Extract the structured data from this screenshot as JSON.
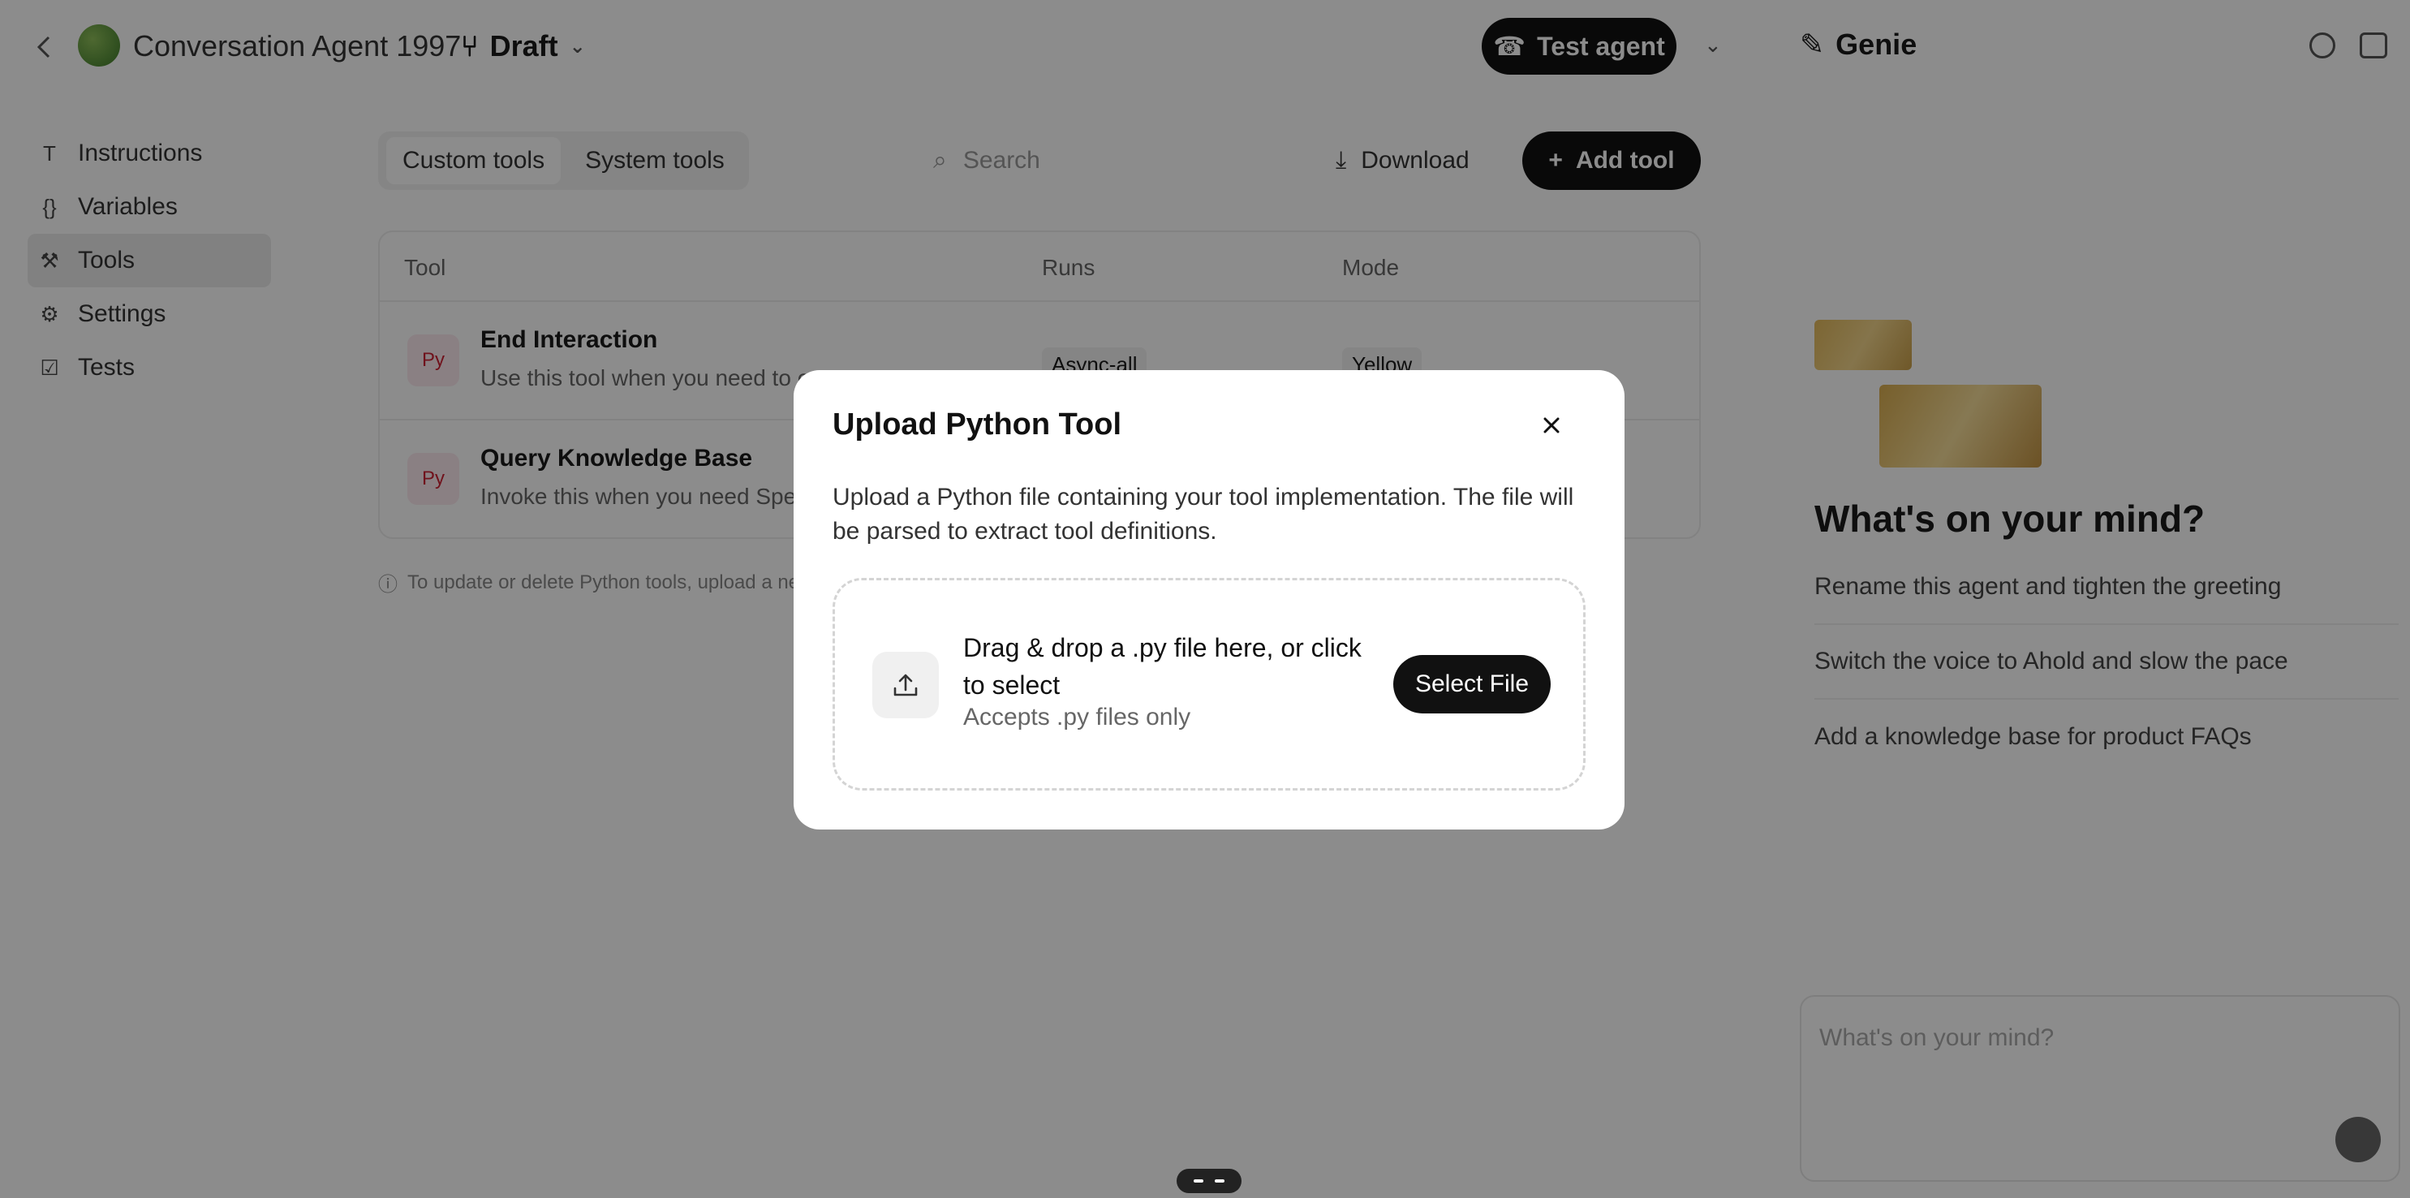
{
  "header": {
    "agent_name": "Conversation Agent 1997",
    "branch": "Draft",
    "test_agent_label": "Test agent",
    "right_title": "Genie"
  },
  "sidebar": {
    "items": [
      {
        "label": "Instructions",
        "icon": "text-icon"
      },
      {
        "label": "Variables",
        "icon": "variables-icon"
      },
      {
        "label": "Tools",
        "icon": "wrench-icon"
      },
      {
        "label": "Settings",
        "icon": "settings-icon"
      },
      {
        "label": "Tests",
        "icon": "tests-icon"
      }
    ]
  },
  "toolbar": {
    "tabs": [
      "Custom tools",
      "System tools"
    ],
    "search_placeholder": "Search",
    "download_label": "Download",
    "add_tool_label": "Add tool"
  },
  "table": {
    "columns": [
      "Tool",
      "Runs",
      "Mode"
    ],
    "rows": [
      {
        "name": "End Interaction",
        "desc": "Use this tool when you need to e",
        "runs": "Async-all",
        "mode": "Yellow"
      },
      {
        "name": "Query Knowledge Base",
        "desc": "Invoke this when you need Spe",
        "runs": "",
        "mode": ""
      }
    ],
    "footnote": "To update or delete Python tools, upload a ne"
  },
  "genie": {
    "prompt_title": "What's on your mind?",
    "suggestions": [
      "Rename this agent and tighten the greeting",
      "Switch the voice to Ahold and slow the pace",
      "Add a knowledge base for product FAQs"
    ],
    "input_placeholder": "What's on your mind?"
  },
  "modal": {
    "title": "Upload Python Tool",
    "description": "Upload a Python file containing your tool implementation. The file will be parsed to extract tool definitions.",
    "drop_text": "Drag & drop a .py file here, or click to select",
    "drop_subtext": "Accepts .py files only",
    "select_button": "Select File",
    "close_icon": "close-icon",
    "upload_icon": "upload-icon"
  }
}
